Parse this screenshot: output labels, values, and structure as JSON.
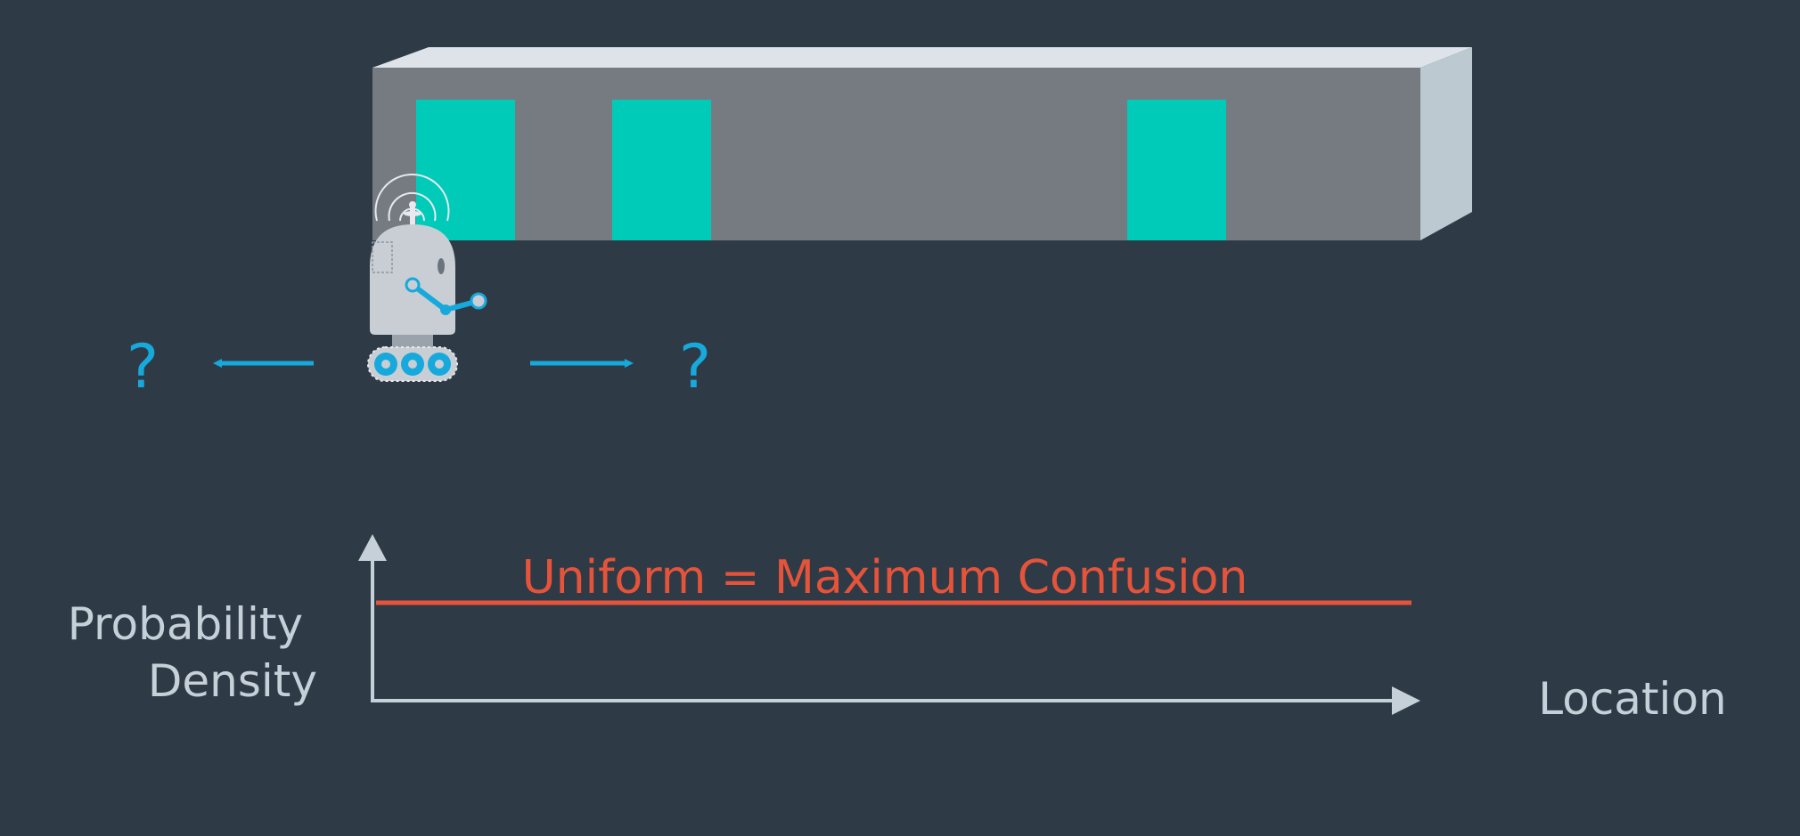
{
  "colors": {
    "background": "#2e3b47",
    "wall_front": "#767b82",
    "wall_top": "#dde3e8",
    "wall_side": "#bdc9d1",
    "door": "#00cbb9",
    "accent_blue": "#17a9dc",
    "uniform_line": "#e5533a",
    "axis": "#c6d0d8",
    "robot_body": "#c9ced4"
  },
  "scene": {
    "unknown_left": "?",
    "unknown_right": "?",
    "doors": [
      {
        "name": "door-1"
      },
      {
        "name": "door-2"
      },
      {
        "name": "door-3"
      }
    ]
  },
  "chart_data": {
    "type": "line",
    "title": "Uniform = Maximum Confusion",
    "ylabel_lines": [
      "Probability",
      "Density"
    ],
    "xlabel": "Location",
    "series": [
      {
        "x": [
          0,
          1
        ],
        "y": [
          1,
          1
        ],
        "description_type": "uniform"
      }
    ],
    "xlim": [
      0,
      1
    ],
    "ylim": [
      0,
      1.7
    ],
    "grid": false
  }
}
